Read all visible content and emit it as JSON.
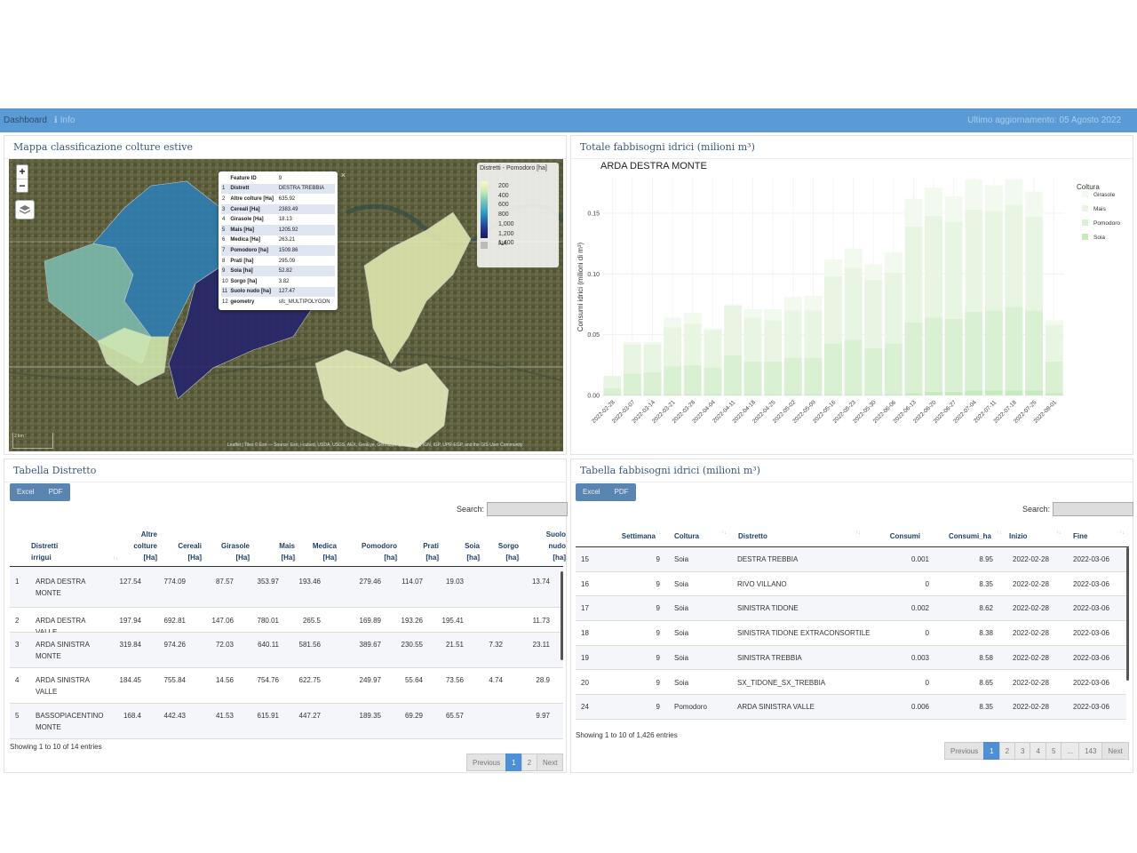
{
  "nav": {
    "dashboard": "Dashboard",
    "info": "Info",
    "last_update": "Ultimo aggiornamento: 05 Agosto 2022"
  },
  "map_panel": {
    "title": "Mappa classificazione colture estive",
    "zoom_in": "+",
    "zoom_out": "−",
    "popup": [
      [
        "",
        "Feature ID",
        "9"
      ],
      [
        "1",
        "Distrett",
        "DESTRA TREBBIA"
      ],
      [
        "2",
        "Altre colture [Ha]",
        "635.92"
      ],
      [
        "3",
        "Cereali [Ha]",
        "2383.49"
      ],
      [
        "4",
        "Girasole [Ha]",
        "18.13"
      ],
      [
        "5",
        "Mais [Ha]",
        "1205.92"
      ],
      [
        "6",
        "Medica [Ha]",
        "263.21"
      ],
      [
        "7",
        "Pomodoro [ha]",
        "1509.86"
      ],
      [
        "8",
        "Prati [ha]",
        "295.09"
      ],
      [
        "9",
        "Soia [ha]",
        "52.82"
      ],
      [
        "10",
        "Sorgo [ha]",
        "3.82"
      ],
      [
        "11",
        "Suolo nudo [ha]",
        "127.47"
      ],
      [
        "12",
        "geometry",
        "sfc_MULTIPOLYGON"
      ]
    ],
    "legend_title": "Distretti - Pomodoro [ha]",
    "legend_labels": [
      "200",
      "400",
      "600",
      "800",
      "1,000",
      "1,200",
      "1,400"
    ],
    "legend_na": "NA",
    "attribution": "Leaflet | Tiles © Esri — Source: Esri, i-cubed, USDA, USGS, AEX, GeoEye, Getmapping, Aerogrid, IGN, IGP, UPR-EGP, and the GIS User Community",
    "scale": "2 km"
  },
  "chart_panel": {
    "title": "Totale fabbisogni idrici (milioni m³)"
  },
  "chart_data": {
    "type": "bar",
    "stacked": true,
    "title": "ARDA DESTRA MONTE",
    "ylabel": "Consumi idrici (milioni di m³)",
    "ylim": [
      0,
      0.18
    ],
    "yticks": [
      "0.00",
      "0.05",
      "0.10",
      "0.15"
    ],
    "legend_title": "Coltura",
    "legend_position": "right",
    "categories": [
      "2022-02-28",
      "2022-03-07",
      "2022-03-14",
      "2022-03-21",
      "2022-03-28",
      "2022-04-04",
      "2022-04-11",
      "2022-04-18",
      "2022-04-25",
      "2022-05-02",
      "2022-05-09",
      "2022-05-16",
      "2022-05-23",
      "2022-05-30",
      "2022-06-06",
      "2022-06-13",
      "2022-06-20",
      "2022-06-27",
      "2022-07-04",
      "2022-07-11",
      "2022-07-18",
      "2022-07-25",
      "2022-08-01"
    ],
    "series": [
      {
        "name": "Soia",
        "color": "#c7e9c0",
        "values": [
          0.001,
          0.001,
          0.001,
          0.001,
          0.001,
          0.001,
          0.001,
          0.001,
          0.001,
          0.001,
          0.001,
          0.001,
          0.001,
          0.001,
          0.001,
          0.002,
          0.003,
          0.003,
          0.004,
          0.004,
          0.004,
          0.004,
          0.002
        ]
      },
      {
        "name": "Pomodoro",
        "color": "#d9f0d3",
        "values": [
          0.005,
          0.017,
          0.018,
          0.023,
          0.024,
          0.022,
          0.032,
          0.027,
          0.027,
          0.03,
          0.03,
          0.042,
          0.045,
          0.038,
          0.042,
          0.058,
          0.061,
          0.06,
          0.065,
          0.066,
          0.069,
          0.066,
          0.026
        ]
      },
      {
        "name": "Mais",
        "color": "#e8f5e2",
        "values": [
          0.01,
          0.024,
          0.023,
          0.032,
          0.034,
          0.031,
          0.041,
          0.036,
          0.034,
          0.039,
          0.039,
          0.055,
          0.059,
          0.056,
          0.058,
          0.079,
          0.084,
          0.08,
          0.084,
          0.082,
          0.084,
          0.077,
          0.03
        ]
      },
      {
        "name": "Girasole",
        "color": "#f2faef",
        "values": [
          0.0,
          0.002,
          0.002,
          0.008,
          0.009,
          0.001,
          0.001,
          0.007,
          0.009,
          0.011,
          0.012,
          0.014,
          0.016,
          0.013,
          0.017,
          0.023,
          0.023,
          0.021,
          0.025,
          0.021,
          0.021,
          0.021,
          0.004
        ]
      }
    ]
  },
  "distretto_panel": {
    "title": "Tabella Distretto",
    "excel": "Excel",
    "pdf": "PDF",
    "search_label": "Search:",
    "columns": [
      {
        "line1": "",
        "line2": "Distretti",
        "line3": "irrigui"
      },
      {
        "line1": "Altre",
        "line2": "colture",
        "line3": "[Ha]"
      },
      {
        "line1": "",
        "line2": "Cereali",
        "line3": "[Ha]"
      },
      {
        "line1": "",
        "line2": "Girasole",
        "line3": "[Ha]"
      },
      {
        "line1": "",
        "line2": "Mais",
        "line3": "[Ha]"
      },
      {
        "line1": "",
        "line2": "Medica",
        "line3": "[Ha]"
      },
      {
        "line1": "",
        "line2": "Pomodoro",
        "line3": "[ha]"
      },
      {
        "line1": "",
        "line2": "Prati",
        "line3": "[ha]"
      },
      {
        "line1": "",
        "line2": "Soia",
        "line3": "[ha]"
      },
      {
        "line1": "",
        "line2": "Sorgo",
        "line3": "[ha]"
      },
      {
        "line1": "Suolo",
        "line2": "nudo",
        "line3": "[ha]"
      }
    ],
    "rows": [
      {
        "idx": "1",
        "name1": "ARDA DESTRA",
        "name2": "MONTE",
        "vals": [
          "127.54",
          "774.09",
          "87.57",
          "353.97",
          "193.46",
          "279.46",
          "114.07",
          "19.03",
          "",
          "13.74"
        ]
      },
      {
        "idx": "2",
        "name1": "ARDA DESTRA VALLE",
        "name2": "",
        "vals": [
          "197.94",
          "692.81",
          "147.06",
          "780.01",
          "265.5",
          "169.89",
          "193.26",
          "195.41",
          "",
          "11.73"
        ]
      },
      {
        "idx": "3",
        "name1": "ARDA SINISTRA",
        "name2": "MONTE",
        "vals": [
          "319.84",
          "974.26",
          "72.03",
          "640.11",
          "581.56",
          "389.67",
          "230.55",
          "21.51",
          "7.32",
          "23.11"
        ]
      },
      {
        "idx": "4",
        "name1": "ARDA SINISTRA",
        "name2": "VALLE",
        "vals": [
          "184.45",
          "755.84",
          "14.56",
          "754.76",
          "622.75",
          "249.97",
          "55.64",
          "73.56",
          "4.74",
          "28.9"
        ]
      },
      {
        "idx": "5",
        "name1": "BASSOPIACENTINO",
        "name2": "MONTE",
        "vals": [
          "168.4",
          "442.43",
          "41.53",
          "615.91",
          "447.27",
          "189.35",
          "69.29",
          "65.57",
          "",
          "9.97"
        ]
      }
    ],
    "info": "Showing 1 to 10 of 14 entries",
    "pager": [
      "Previous",
      "1",
      "2",
      "Next"
    ]
  },
  "fabbisogni_panel": {
    "title": "Tabella fabbisogni idrici (milioni m³)",
    "excel": "Excel",
    "pdf": "PDF",
    "search_label": "Search:",
    "columns": [
      "Settimana",
      "Coltura",
      "Distretto",
      "Consumi",
      "Consumi_ha",
      "Inizio",
      "Fine"
    ],
    "rows": [
      [
        "15",
        "9",
        "Soia",
        "DESTRA TREBBIA",
        "0.001",
        "8.95",
        "2022-02-28",
        "2022-03-06"
      ],
      [
        "16",
        "9",
        "Soia",
        "RIVO VILLANO",
        "0",
        "8.35",
        "2022-02-28",
        "2022-03-06"
      ],
      [
        "17",
        "9",
        "Soia",
        "SINISTRA TIDONE",
        "0.002",
        "8.62",
        "2022-02-28",
        "2022-03-06"
      ],
      [
        "18",
        "9",
        "Soia",
        "SINISTRA TIDONE EXTRACONSORTILE",
        "0",
        "8.38",
        "2022-02-28",
        "2022-03-06"
      ],
      [
        "19",
        "9",
        "Soia",
        "SINISTRA TREBBIA",
        "0.003",
        "8.58",
        "2022-02-28",
        "2022-03-06"
      ],
      [
        "20",
        "9",
        "Soia",
        "SX_TIDONE_SX_TREBBIA",
        "0",
        "8.65",
        "2022-02-28",
        "2022-03-06"
      ],
      [
        "24",
        "9",
        "Pomodoro",
        "ARDA SINISTRA VALLE",
        "0.006",
        "8.35",
        "2022-02-28",
        "2022-03-06"
      ]
    ],
    "info": "Showing 1 to 10 of 1,426 entries",
    "pager": [
      "Previous",
      "1",
      "2",
      "3",
      "4",
      "5",
      "...",
      "143",
      "Next"
    ]
  }
}
